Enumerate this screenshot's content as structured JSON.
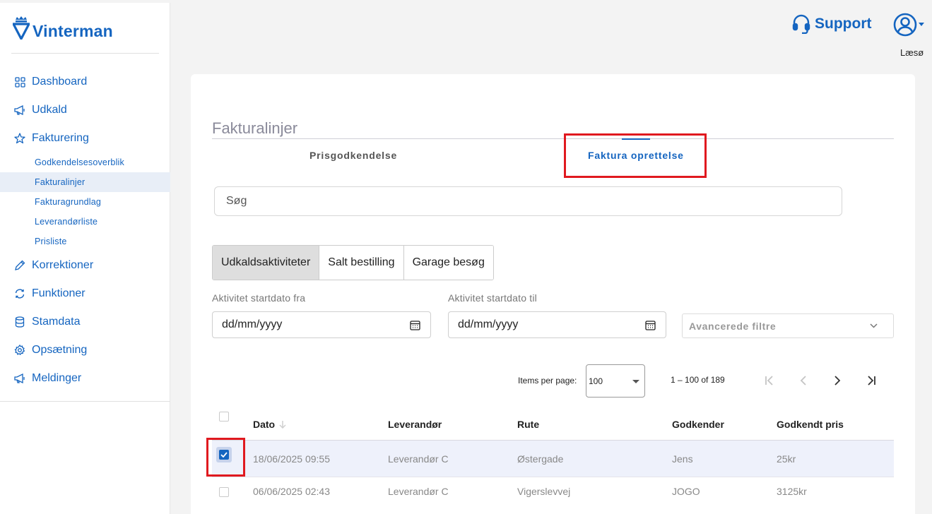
{
  "app": {
    "brand": "Vinterman",
    "accent": "#1565c0",
    "highlight": "#e0191f"
  },
  "sidebar": {
    "items": [
      {
        "label": "Dashboard",
        "icon": "grid-icon"
      },
      {
        "label": "Udkald",
        "icon": "megaphone-icon"
      },
      {
        "label": "Fakturering",
        "icon": "star-icon"
      },
      {
        "label": "Korrektioner",
        "icon": "pencil-icon"
      },
      {
        "label": "Funktioner",
        "icon": "refresh-icon"
      },
      {
        "label": "Stamdata",
        "icon": "database-icon"
      },
      {
        "label": "Opsætning",
        "icon": "gear-icon"
      },
      {
        "label": "Meldinger",
        "icon": "megaphone-icon"
      }
    ],
    "fakturering_sub": [
      "Godkendelsesoverblik",
      "Fakturalinjer",
      "Fakturagrundlag",
      "Leverandørliste",
      "Prisliste"
    ],
    "active_sub": "Fakturalinjer"
  },
  "header": {
    "support_label": "Support",
    "user_name": "Læsø"
  },
  "main": {
    "title": "Fakturalinjer",
    "tabs": [
      {
        "label": "Prisgodkendelse"
      },
      {
        "label": "Faktura oprettelse",
        "active": true
      }
    ],
    "search_placeholder": "Søg",
    "segments": [
      {
        "label": "Udkaldsaktiviteter",
        "active": true
      },
      {
        "label": "Salt bestilling"
      },
      {
        "label": "Garage besøg"
      }
    ],
    "filters": {
      "from_label": "Aktivitet startdato fra",
      "to_label": "Aktivitet startdato til",
      "date_placeholder": "dd/mm/yyyy",
      "advanced_label": "Avancerede filtre"
    },
    "paginator": {
      "items_per_page_label": "Items per page:",
      "page_size": "100",
      "range": "1 – 100 of 189"
    },
    "table": {
      "columns": [
        "Dato",
        "Leverandør",
        "Rute",
        "Godkender",
        "Godkendt pris"
      ],
      "rows": [
        {
          "dato": "18/06/2025 09:55",
          "leverandor": "Leverandør C",
          "rute": "Østergade",
          "godkender": "Jens",
          "pris": "25kr",
          "checked": true
        },
        {
          "dato": "06/06/2025 02:43",
          "leverandor": "Leverandør C",
          "rute": "Vigerslevvej",
          "godkender": "JOGO",
          "pris": "3125kr",
          "checked": false
        }
      ]
    }
  }
}
